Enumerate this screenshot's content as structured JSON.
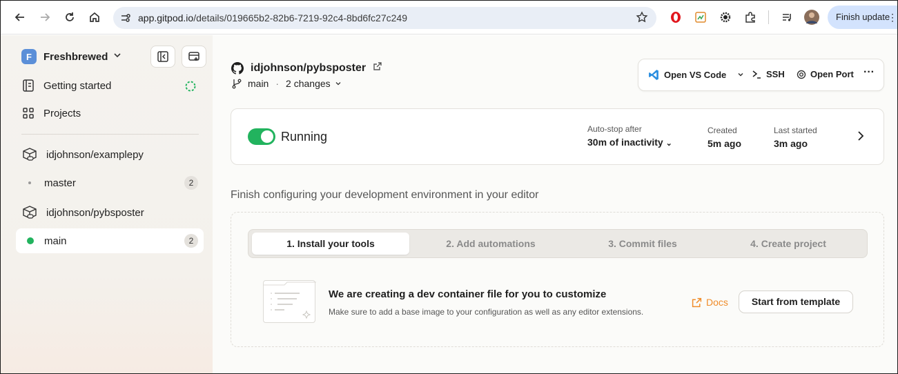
{
  "browser": {
    "url_host": "app.gitpod.io",
    "url_path": "/details/019665b2-82b6-7219-92c4-8bd6fc27c249",
    "finish_update_label": "Finish update"
  },
  "sidebar": {
    "org_initial": "F",
    "org_name": "Freshbrewed",
    "nav": [
      {
        "label": "Getting started"
      },
      {
        "label": "Projects"
      }
    ],
    "repos": [
      {
        "name": "idjohnson/examplepy",
        "branch": "master",
        "count": "2"
      },
      {
        "name": "idjohnson/pybsposter",
        "branch": "main",
        "count": "2"
      }
    ]
  },
  "main": {
    "repo_name": "idjohnson/pybsposter",
    "branch": "main",
    "changes": "2 changes",
    "actions": {
      "open_vscode": "Open VS Code",
      "ssh": "SSH",
      "open_port": "Open Port"
    },
    "status": {
      "state": "Running",
      "autostop_label": "Auto-stop after",
      "autostop_value": "30m of inactivity",
      "created_label": "Created",
      "created_value": "5m ago",
      "last_started_label": "Last started",
      "last_started_value": "3m ago"
    },
    "setup": {
      "title": "Finish configuring your development environment in your editor",
      "tabs": [
        {
          "label": "1. Install your tools",
          "active": true
        },
        {
          "label": "2. Add automations",
          "active": false
        },
        {
          "label": "3. Commit files",
          "active": false
        },
        {
          "label": "4. Create project",
          "active": false
        }
      ],
      "tip_title": "We are creating a dev container file for you to customize",
      "tip_sub": "Make sure to add a base image to your configuration as well as any editor extensions.",
      "docs_label": "Docs",
      "template_button": "Start from template"
    }
  },
  "colors": {
    "accent_green": "#22b35e",
    "docs_orange": "#f08c2a",
    "chrome_blue": "#d3e3fd"
  }
}
